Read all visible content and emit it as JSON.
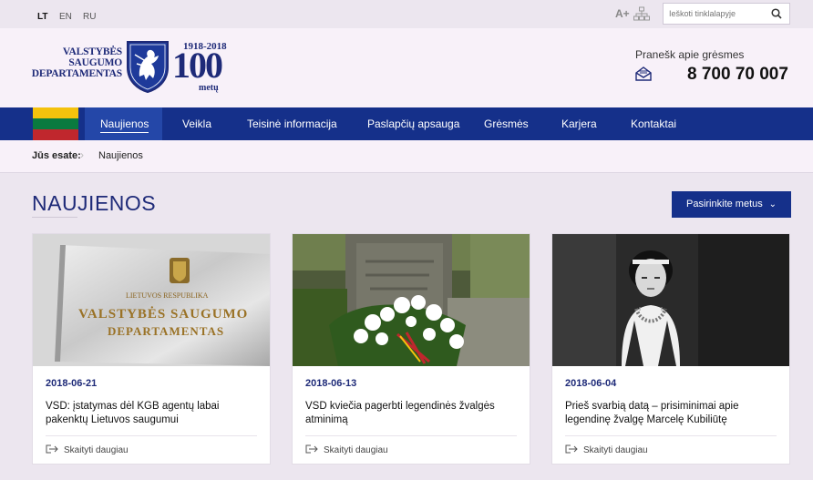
{
  "languages": [
    {
      "code": "LT",
      "active": true
    },
    {
      "code": "EN",
      "active": false
    },
    {
      "code": "RU",
      "active": false
    }
  ],
  "tools": {
    "font_size_icon": "text-size-icon",
    "font_size_label": "A+",
    "sitemap_icon": "sitemap-icon"
  },
  "search": {
    "placeholder": "Ieškoti tinklalapyje",
    "icon": "search-icon"
  },
  "logo": {
    "line1": "VALSTYBĖS",
    "line2": "SAUGUMO",
    "line3": "DEPARTAMENTAS",
    "years": "1918-2018",
    "number": "100",
    "suffix": "metų"
  },
  "threat": {
    "label": "Pranešk apie grėsmes",
    "phone": "8 700 70 007",
    "icon": "mail-icon"
  },
  "flag_colors": [
    "#f4c20d",
    "#0a7a3f",
    "#c0272d"
  ],
  "nav": [
    {
      "label": "Naujienos",
      "active": true
    },
    {
      "label": "Veikla",
      "active": false
    },
    {
      "label": "Teisinė informacija",
      "active": false
    },
    {
      "label": "Paslapčių apsauga",
      "active": false
    },
    {
      "label": "Grėsmės",
      "active": false
    },
    {
      "label": "Karjera",
      "active": false
    },
    {
      "label": "Kontaktai",
      "active": false
    }
  ],
  "breadcrumb": {
    "label": "Jūs esate:",
    "current": "Naujienos"
  },
  "page": {
    "title": "NAUJIENOS",
    "year_button": "Pasirinkite metus"
  },
  "cards": [
    {
      "date": "2018-06-21",
      "title": "VSD: įstatymas dėl KGB agentų labai pakenktų Lietuvos saugumui",
      "more": "Skaityti daugiau"
    },
    {
      "date": "2018-06-13",
      "title": "VSD kviečia pagerbti legendinės žvalgės atminimą",
      "more": "Skaityti daugiau"
    },
    {
      "date": "2018-06-04",
      "title": "Prieš svarbią datą – prisiminimai apie legendinę žvalgę Marcelę Kubiliūtę",
      "more": "Skaityti daugiau"
    }
  ],
  "sign": {
    "line1": "LIETUVOS RESPUBLIKA",
    "line2": "VALSTYBĖS SAUGUMO",
    "line3": "DEPARTAMENTAS"
  },
  "colors": {
    "brand_blue": "#15308a",
    "title_blue": "#1e2a78",
    "background": "#ece6ef"
  }
}
